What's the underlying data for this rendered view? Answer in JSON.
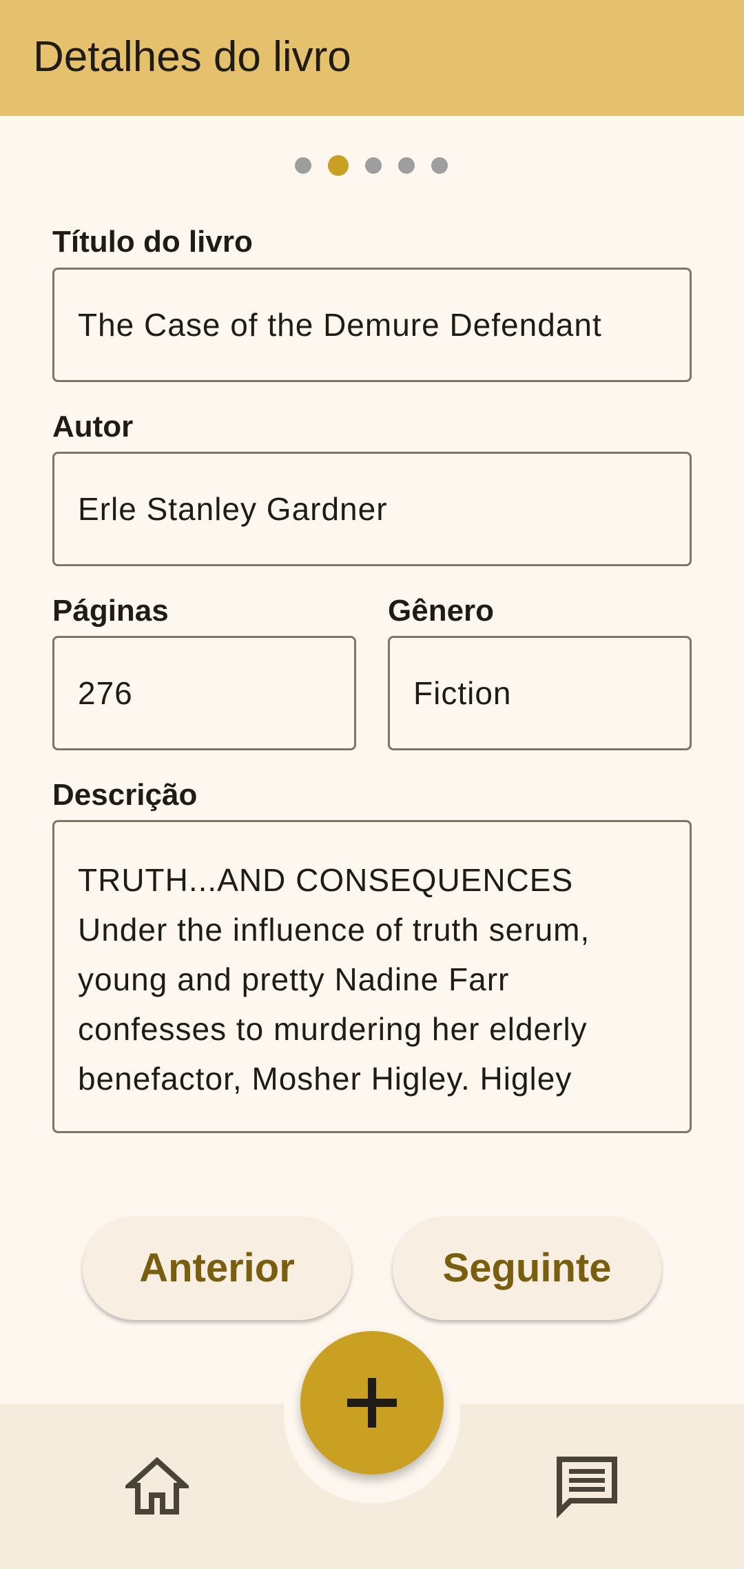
{
  "appbar": {
    "title": "Detalhes do livro"
  },
  "pager": {
    "total": 5,
    "active_index": 1
  },
  "form": {
    "title_label": "Título do livro",
    "title_value": "The Case of the Demure Defendant",
    "author_label": "Autor",
    "author_value": "Erle Stanley Gardner",
    "pages_label": "Páginas",
    "pages_value": "276",
    "genre_label": "Gênero",
    "genre_value": "Fiction",
    "description_label": "Descrição",
    "description_value": "TRUTH...AND CONSEQUENCES\nUnder the influence of truth serum,\nyoung and pretty Nadine Farr\nconfesses to murdering her elderly\nbenefactor, Mosher Higley. Higley"
  },
  "buttons": {
    "previous_label": "Anterior",
    "next_label": "Seguinte"
  },
  "fab": {
    "icon": "plus-icon"
  },
  "bottom_nav": {
    "home_icon": "home-icon",
    "messages_icon": "chat-icon"
  },
  "colors": {
    "appbar": "#e5c16d",
    "accent": "#c9a021",
    "button_text": "#7a5e10",
    "background": "#fdf7f0"
  }
}
